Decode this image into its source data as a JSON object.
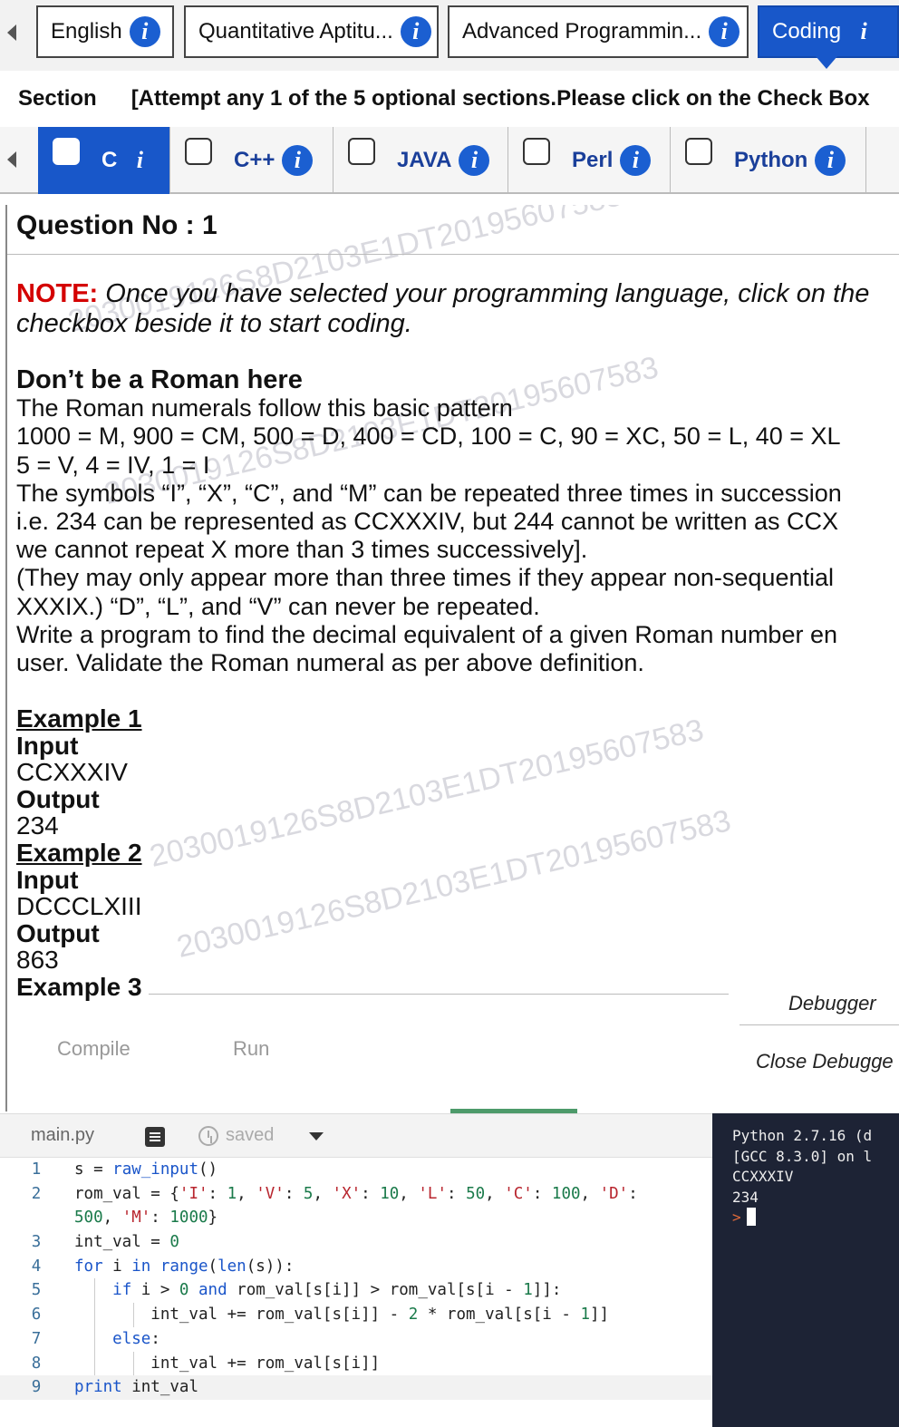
{
  "sections": [
    {
      "label": "English",
      "active": false
    },
    {
      "label": "Quantitative Aptitu...",
      "active": false
    },
    {
      "label": "Advanced Programmin...",
      "active": false
    },
    {
      "label": "Coding",
      "active": true
    }
  ],
  "section_row": {
    "label": "Section",
    "instruction": "[Attempt any 1 of the 5 optional sections.Please click on the Check Box"
  },
  "languages": [
    {
      "label": "C",
      "active": true
    },
    {
      "label": "C++",
      "active": false
    },
    {
      "label": "JAVA",
      "active": false
    },
    {
      "label": "Perl",
      "active": false
    },
    {
      "label": "Python",
      "active": false
    }
  ],
  "question": {
    "heading": "Question No : 1",
    "note_prefix": "NOTE:",
    "note_line1": " Once you have selected your programming language, click on the",
    "note_line2": "checkbox beside it to start coding.",
    "title": "Don’t be a Roman here",
    "body": [
      "The Roman numerals follow this basic pattern",
      "1000 = M, 900 = CM, 500 = D, 400 = CD, 100 = C, 90 = XC, 50 = L, 40 = XL",
      "5 = V, 4 = IV, 1 = I",
      "The symbols “I”, “X”, “C”, and “M” can be repeated three times in succession",
      "i.e. 234 can be represented as CCXXXIV, but 244 cannot be written as CCX",
      "we cannot repeat X more than 3 times successively].",
      "(They may only appear more than three times if they appear non-sequential",
      "XXXIX.) “D”, “L”, and “V” can never be repeated.",
      "Write a program to find the decimal equivalent of a given Roman number en",
      "user. Validate the Roman numeral as per above definition."
    ],
    "examples": [
      {
        "title": "Example 1",
        "input_label": "Input",
        "input": "CCXXXIV",
        "output_label": "Output",
        "output": "234"
      },
      {
        "title": "Example 2",
        "input_label": "Input",
        "input": "DCCCLXIII",
        "output_label": "Output",
        "output": "863"
      }
    ],
    "example3_title": "Example 3",
    "watermark": "2030019126S8D2103E1DT2019560758​3"
  },
  "actions": {
    "compile": "Compile",
    "run": "Run",
    "debugger": "Debugger",
    "close_debugger": "Close Debugge"
  },
  "editor": {
    "filename": "main.py",
    "status": "saved",
    "lines": [
      {
        "n": "1",
        "html": "s = <span class='kw'>raw_input</span>()"
      },
      {
        "n": "2",
        "html": "rom_val = {<span class='st'>'I'</span>: <span class='nm'>1</span>, <span class='st'>'V'</span>: <span class='nm'>5</span>, <span class='st'>'X'</span>: <span class='nm'>10</span>, <span class='st'>'L'</span>: <span class='nm'>50</span>, <span class='st'>'C'</span>: <span class='nm'>100</span>, <span class='st'>'D'</span>:\n<span class='nm'>500</span>, <span class='st'>'M'</span>: <span class='nm'>1000</span>}"
      },
      {
        "n": "3",
        "html": "int_val = <span class='nm'>0</span>"
      },
      {
        "n": "4",
        "html": "<span class='kw'>for</span> i <span class='kw'>in</span> <span class='kw'>range</span>(<span class='kw'>len</span>(s)):"
      },
      {
        "n": "5",
        "html": "    <span class='kw'>if</span> i &gt; <span class='nm'>0</span> <span class='kw'>and</span> rom_val[s[i]] &gt; rom_val[s[i - <span class='nm'>1</span>]]:"
      },
      {
        "n": "6",
        "html": "        int_val += rom_val[s[i]] - <span class='nm'>2</span> * rom_val[s[i - <span class='nm'>1</span>]]"
      },
      {
        "n": "7",
        "html": "    <span class='kw'>else</span>:"
      },
      {
        "n": "8",
        "html": "        int_val += rom_val[s[i]]"
      },
      {
        "n": "9",
        "html": "<span class='kw'>print</span> int_val"
      }
    ]
  },
  "console": {
    "lines": [
      "Python 2.7.16 (d",
      "[GCC 8.3.0] on l",
      "CCXXXIV",
      "234"
    ],
    "prompt": ">"
  }
}
